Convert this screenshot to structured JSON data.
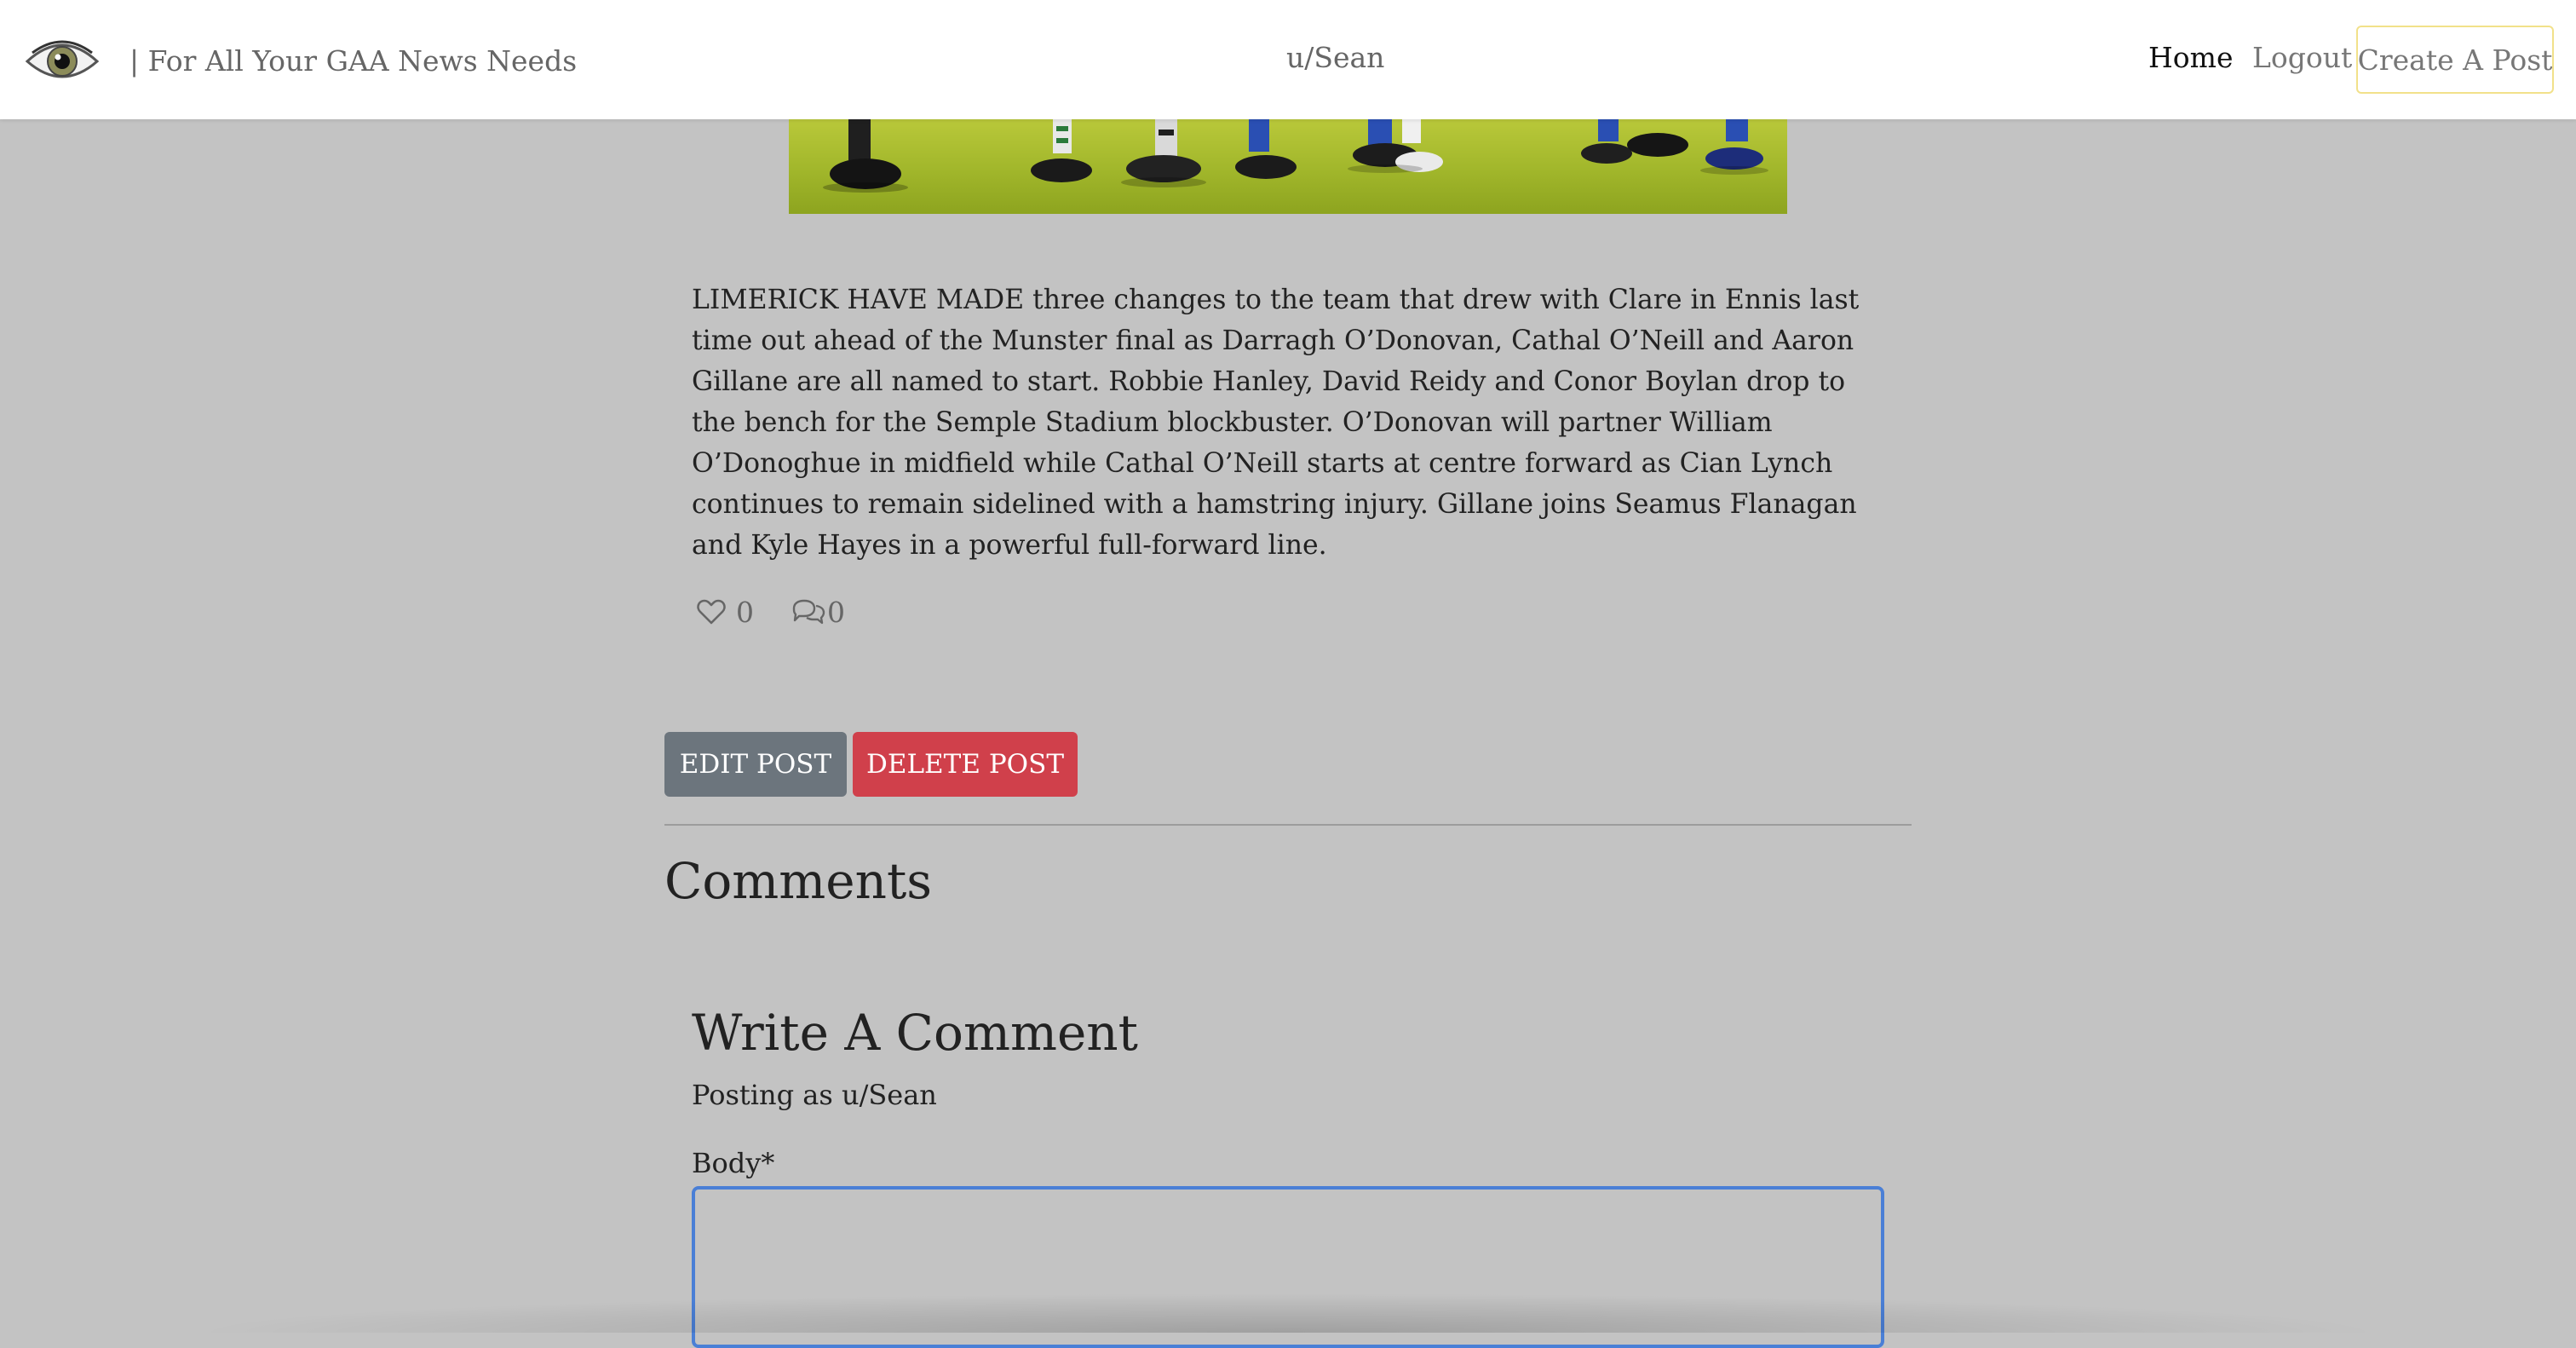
{
  "header": {
    "logo_icon": "eye-icon",
    "tagline": "| For All Your GAA News Needs",
    "username": "u/Sean",
    "nav": {
      "home": "Home",
      "logout": "Logout",
      "create_post": "Create A Post"
    }
  },
  "post": {
    "body": "LIMERICK HAVE MADE three changes to the team that drew with Clare in Ennis last time out ahead of the Munster final as Darragh O’Donovan, Cathal O’Neill and Aaron Gillane are all named to start. Robbie Hanley, David Reidy and Conor Boylan drop to the bench for the Semple Stadium blockbuster. O’Donovan will partner William O’Donoghue in midfield while Cathal O’Neill starts at centre forward as Cian Lynch continues to remain sidelined with a hamstring injury. Gillane joins Seamus Flanagan and Kyle Hayes in a powerful full-forward line.",
    "likes": "0",
    "comments": "0",
    "like_icon": "heart-icon",
    "comment_icon": "comment-bubble-icon",
    "edit_label": "EDIT POST",
    "delete_label": "DELETE POST"
  },
  "comments": {
    "heading": "Comments",
    "form": {
      "heading": "Write A Comment",
      "posting_as": "Posting as u/Sean",
      "body_label": "Body*",
      "body_value": ""
    }
  },
  "colors": {
    "page_bg": "#c3c3c3",
    "navbar_bg": "#ffffff",
    "edit_button": "#6c757d",
    "delete_button": "#d0404b",
    "input_focus_border": "#4a7fd6",
    "create_post_border": "#f2e18a"
  }
}
